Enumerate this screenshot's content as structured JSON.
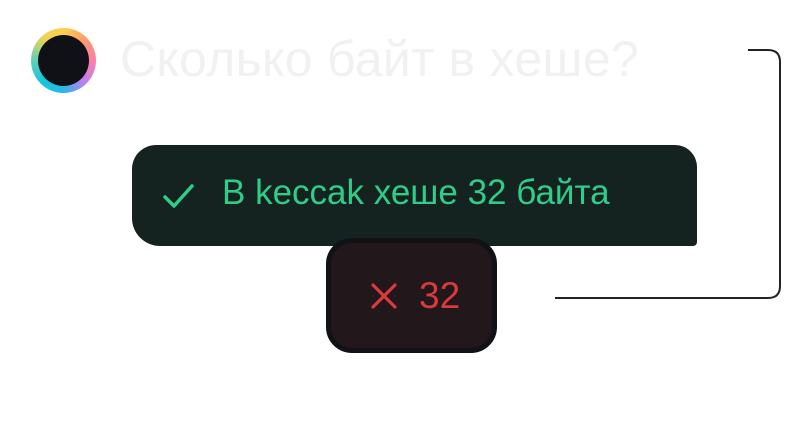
{
  "question": {
    "title": "Сколько байт в хеше?",
    "avatar_icon": "gradient-ring-avatar"
  },
  "correct_answer": {
    "icon": "check-icon",
    "text": "В keccak хеше 32 байта",
    "color": "#2fcc8a"
  },
  "wrong_answer": {
    "icon": "x-icon",
    "text": "32",
    "color": "#d93a3c"
  }
}
